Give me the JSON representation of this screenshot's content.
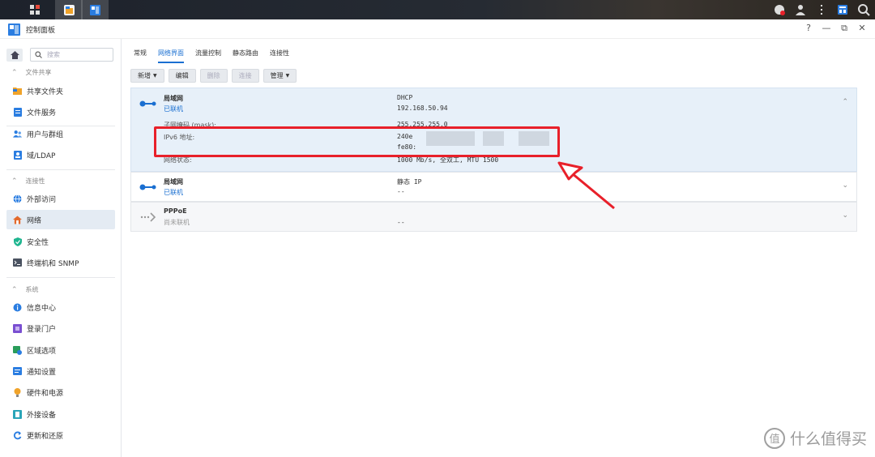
{
  "window": {
    "title": "控制面板",
    "controls": [
      "?",
      "—",
      "⧉",
      "✕"
    ]
  },
  "sidebar": {
    "search_placeholder": "搜索",
    "sections": [
      {
        "label": "文件共享",
        "items": [
          {
            "label": "共享文件夹",
            "icon": "folder-icon",
            "color": "#f0a32a"
          },
          {
            "label": "文件服务",
            "icon": "file-service-icon",
            "color": "#2a7de1"
          }
        ]
      },
      {
        "label": "",
        "items": [
          {
            "label": "用户与群组",
            "icon": "users-icon",
            "color": "#2a7de1"
          },
          {
            "label": "域/LDAP",
            "icon": "ldap-icon",
            "color": "#2a7de1"
          }
        ]
      },
      {
        "label": "连接性",
        "items": [
          {
            "label": "外部访问",
            "icon": "globe-icon",
            "color": "#2a7de1"
          },
          {
            "label": "网络",
            "icon": "network-home-icon",
            "color": "#e36a2c",
            "selected": true
          },
          {
            "label": "安全性",
            "icon": "shield-icon",
            "color": "#1fb58f"
          },
          {
            "label": "终端机和 SNMP",
            "icon": "terminal-icon",
            "color": "#556"
          }
        ]
      },
      {
        "label": "系统",
        "items": [
          {
            "label": "信息中心",
            "icon": "info-icon",
            "color": "#2a7de1"
          },
          {
            "label": "登录门户",
            "icon": "portal-icon",
            "color": "#7a4fd1"
          },
          {
            "label": "区域选项",
            "icon": "region-icon",
            "color": "#2a9d5a"
          },
          {
            "label": "通知设置",
            "icon": "notification-icon",
            "color": "#2a7de1"
          },
          {
            "label": "硬件和电源",
            "icon": "bulb-icon",
            "color": "#f0a32a"
          },
          {
            "label": "外接设备",
            "icon": "external-device-icon",
            "color": "#2aa5b8"
          },
          {
            "label": "更新和还原",
            "icon": "update-icon",
            "color": "#2a7de1"
          }
        ]
      }
    ]
  },
  "tabs": [
    "常规",
    "网络界面",
    "流量控制",
    "静态路由",
    "连接性"
  ],
  "active_tab": 1,
  "toolbar": {
    "new": "新增",
    "edit": "编辑",
    "delete": "删除",
    "connect": "连接",
    "manage": "管理"
  },
  "interfaces": [
    {
      "name": "局域网",
      "status": "已联机",
      "mode": "DHCP",
      "ip": "192.168.50.94",
      "mask_label": "子网掩码 (mask):",
      "mask": "255.255.255.0",
      "ipv6_label": "IPv6 地址:",
      "ipv6_1": "240e",
      "ipv6_2": "fe80:",
      "net_label": "网络状态:",
      "net_status": "1000 Mb/s, 全双工, MTU 1500"
    },
    {
      "name": "局域网",
      "status": "已联机",
      "mode": "静态 IP",
      "ip": "--"
    },
    {
      "name": "PPPoE",
      "status": "尚未联机",
      "ip": "--"
    }
  ],
  "watermark": {
    "text": "什么值得买",
    "logo": "值"
  },
  "accent_color": "#1a6fd1",
  "highlight_color": "#e8202a"
}
